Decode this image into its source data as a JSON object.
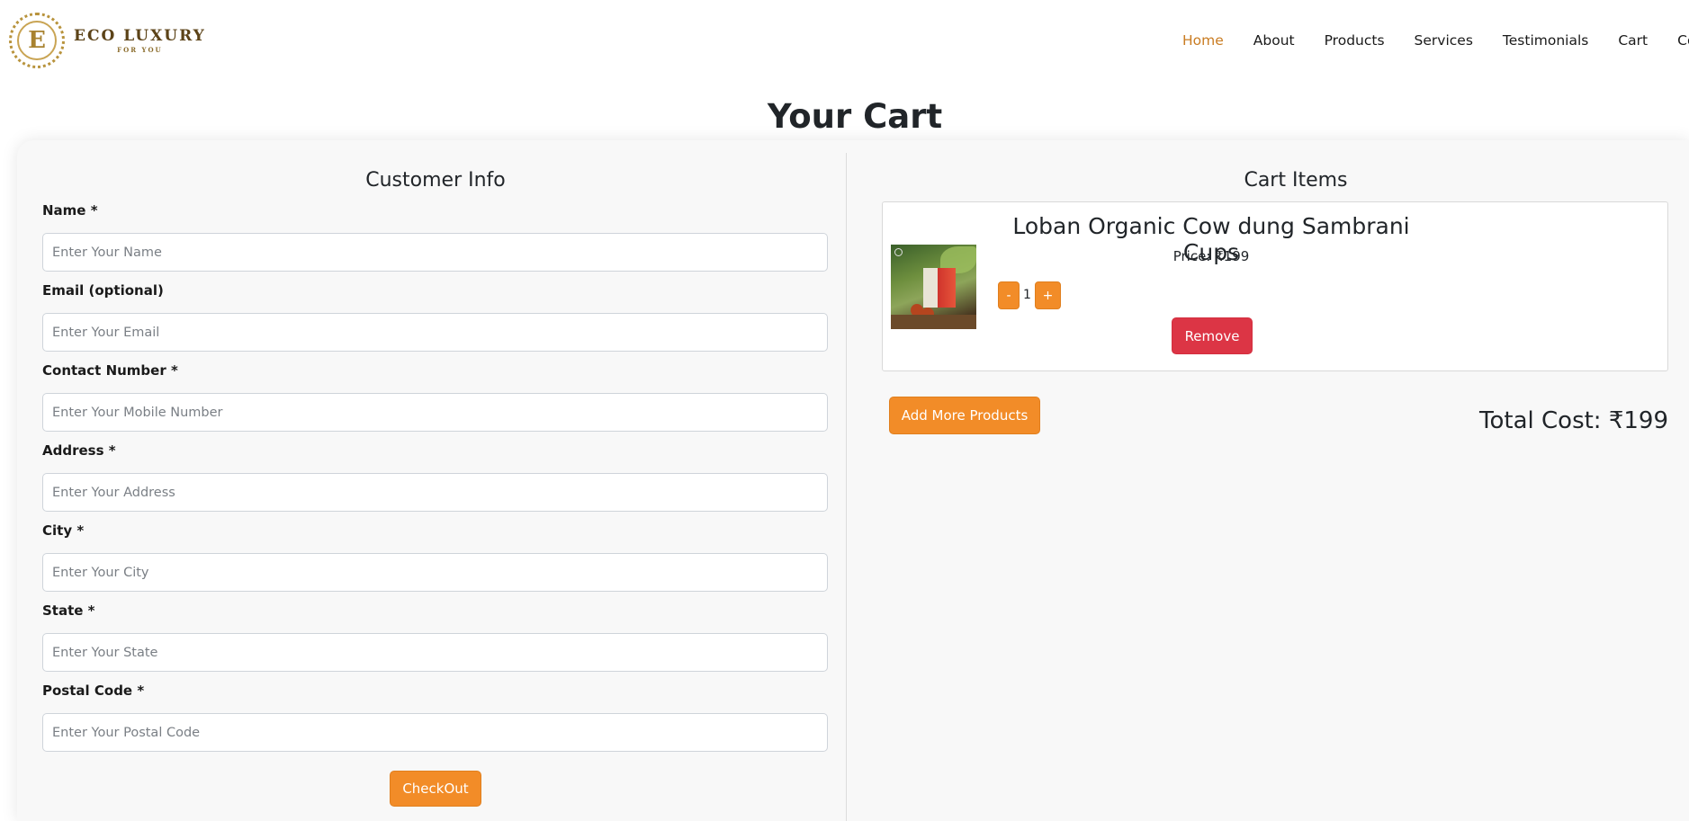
{
  "brand": {
    "seal_letter": "E",
    "name": "ECO LUXURY",
    "tagline": "FOR YOU",
    "gold_color": "#b8933c"
  },
  "nav": {
    "items": [
      {
        "label": "Home",
        "active": true
      },
      {
        "label": "About",
        "active": false
      },
      {
        "label": "Products",
        "active": false
      },
      {
        "label": "Services",
        "active": false
      },
      {
        "label": "Testimonials",
        "active": false
      },
      {
        "label": "Cart",
        "active": false
      },
      {
        "label": "Contac",
        "active": false
      }
    ],
    "active_color": "#c97c22"
  },
  "page": {
    "title": "Your Cart"
  },
  "customer_info": {
    "title": "Customer Info",
    "fields": [
      {
        "label": "Name *",
        "placeholder": "Enter Your Name",
        "value": ""
      },
      {
        "label": "Email (optional)",
        "placeholder": "Enter Your Email",
        "value": ""
      },
      {
        "label": "Contact Number *",
        "placeholder": "Enter Your Mobile Number",
        "value": ""
      },
      {
        "label": "Address *",
        "placeholder": "Enter Your Address",
        "value": ""
      },
      {
        "label": "City *",
        "placeholder": "Enter Your City",
        "value": ""
      },
      {
        "label": "State *",
        "placeholder": "Enter Your State",
        "value": ""
      },
      {
        "label": "Postal Code *",
        "placeholder": "Enter Your Postal Code",
        "value": ""
      }
    ],
    "checkout_label": "CheckOut"
  },
  "cart": {
    "title": "Cart Items",
    "items": [
      {
        "name": "Loban Organic Cow dung Sambrani Cups",
        "price_text": "Price: ₹199",
        "quantity": "1",
        "minus_label": "-",
        "plus_label": "+",
        "remove_label": "Remove"
      }
    ],
    "add_more_label": "Add More Products",
    "total_text": "Total Cost: ₹199"
  },
  "colors": {
    "accent_orange": "#f28c28",
    "remove_red": "#dc3545"
  }
}
